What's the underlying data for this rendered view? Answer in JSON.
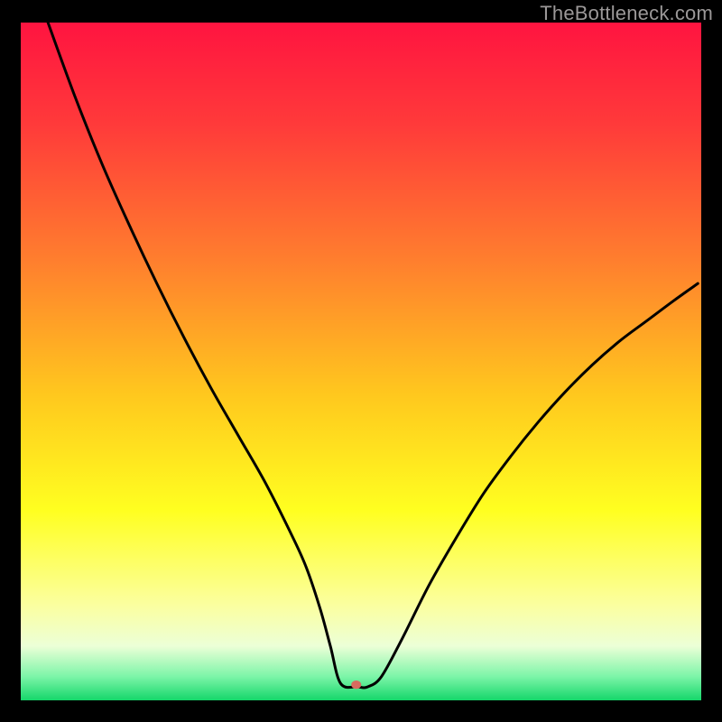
{
  "watermark": "TheBottleneck.com",
  "chart_data": {
    "type": "line",
    "title": "",
    "xlabel": "",
    "ylabel": "",
    "xlim": [
      0,
      100
    ],
    "ylim": [
      0,
      100
    ],
    "grid": false,
    "legend": false,
    "gradient_stops": [
      {
        "offset": 0.0,
        "color": "#ff1440"
      },
      {
        "offset": 0.15,
        "color": "#ff3a3a"
      },
      {
        "offset": 0.35,
        "color": "#ff7e2e"
      },
      {
        "offset": 0.55,
        "color": "#ffc81e"
      },
      {
        "offset": 0.72,
        "color": "#ffff20"
      },
      {
        "offset": 0.86,
        "color": "#fbffa0"
      },
      {
        "offset": 0.92,
        "color": "#ecffd7"
      },
      {
        "offset": 0.965,
        "color": "#7cf5a8"
      },
      {
        "offset": 1.0,
        "color": "#15d66a"
      }
    ],
    "series": [
      {
        "name": "bottleneck-curve",
        "color": "#000000",
        "x": [
          4,
          8,
          12,
          16,
          20,
          24,
          28,
          32,
          36,
          40,
          42,
          44,
          45.5,
          47,
          49.5,
          51,
          53,
          56,
          60,
          64,
          68,
          72,
          76,
          80,
          84,
          88,
          92,
          96,
          99.5
        ],
        "y": [
          100,
          89,
          79,
          70,
          61.5,
          53.5,
          46,
          39,
          32,
          24,
          19.5,
          13.5,
          8,
          2.5,
          2,
          2,
          3.5,
          9,
          17,
          24,
          30.5,
          36,
          41,
          45.5,
          49.5,
          53,
          56,
          59,
          61.5
        ]
      }
    ],
    "marker": {
      "x": 49.3,
      "y": 2.3,
      "color": "#d86a5f",
      "rx": 5.5,
      "ry": 4.7
    }
  }
}
